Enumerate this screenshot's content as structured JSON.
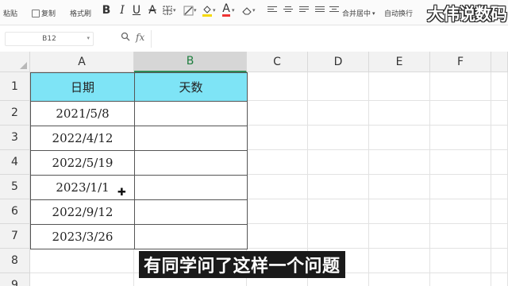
{
  "toolbar": {
    "paste_label": "粘贴",
    "copy_label": "复制",
    "format_painter_label": "格式刷",
    "bold": "B",
    "italic": "I",
    "underline": "U",
    "strike": "A",
    "font_color": "A",
    "merge_label": "合并居中",
    "autowrap_label": "自动换行"
  },
  "watermark": "大伟说数码",
  "formula_bar": {
    "name_box": "B12",
    "fx_label": "fx",
    "formula": ""
  },
  "sheet": {
    "columns": [
      "A",
      "B",
      "C",
      "D",
      "E",
      "F"
    ],
    "selected_column": "B",
    "rows": [
      "1",
      "2",
      "3",
      "4",
      "5",
      "6",
      "7",
      "8",
      "9"
    ],
    "table": {
      "header": [
        "日期",
        "天数"
      ],
      "dates": [
        "2021/5/8",
        "2022/4/12",
        "2022/5/19",
        "2023/1/1",
        "2022/9/12",
        "2023/3/26"
      ],
      "days": [
        "",
        "",
        "",
        "",
        "",
        ""
      ]
    },
    "header_fill": "#7EE4F6",
    "selected_column_color": "#2E8B57"
  },
  "subtitle": "有同学问了这样一个问题"
}
